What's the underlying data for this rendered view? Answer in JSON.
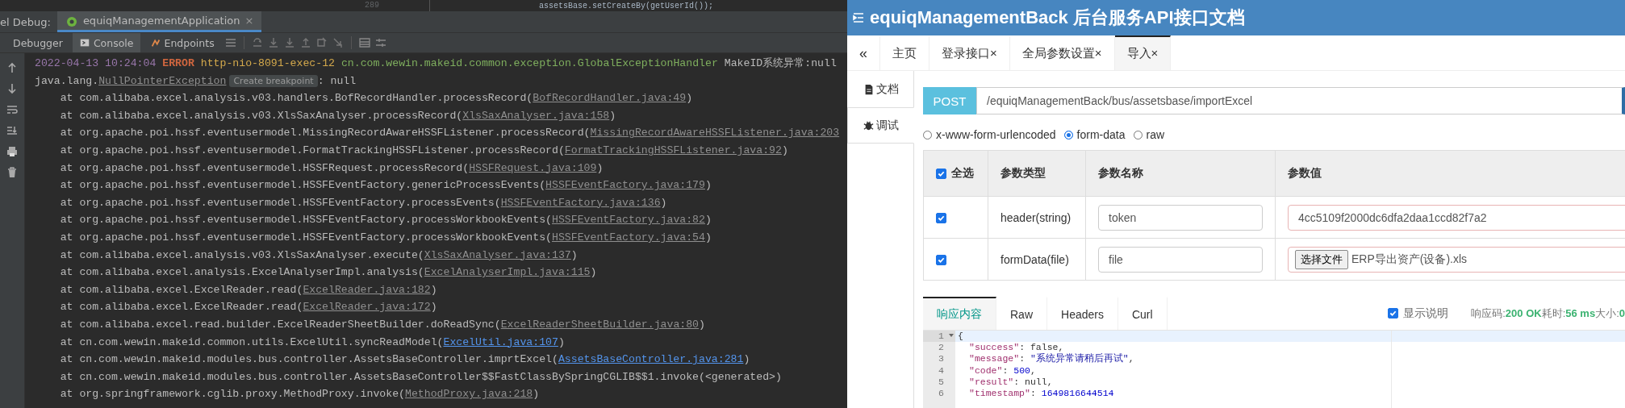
{
  "editor_strip": {
    "line_number": "289",
    "code": "assetsBase.setCreateBy(getUserId());"
  },
  "run_bar": {
    "label": "el Debug:",
    "tab": "equiqManagementApplication",
    "close": "×"
  },
  "tool_tabs": [
    {
      "label": "Debugger",
      "selected": false
    },
    {
      "label": "Console",
      "selected": true
    },
    {
      "label": "Endpoints",
      "selected": false
    }
  ],
  "console": [
    {
      "kind": "log",
      "date": "2022-04-13 10:24:04",
      "level": "ERROR",
      "thread": "http-nio-8091-exec-12",
      "logger": "cn.com.wewin.makeid.common.exception.GlobalExceptionHandler",
      "message": "MakeID系统异常:null"
    },
    {
      "kind": "exception",
      "prefix": "java.lang.",
      "exception": "NullPointerException",
      "hint": "Create breakpoint",
      "suffix": ": null"
    },
    {
      "kind": "frame",
      "text": "at com.alibaba.excel.analysis.v03.handlers.BofRecordHandler.processRecord(",
      "link": "BofRecordHandler.java:49",
      "after": ")",
      "project": false
    },
    {
      "kind": "frame",
      "text": "at com.alibaba.excel.analysis.v03.XlsSaxAnalyser.processRecord(",
      "link": "XlsSaxAnalyser.java:158",
      "after": ")",
      "project": false
    },
    {
      "kind": "frame",
      "text": "at org.apache.poi.hssf.eventusermodel.MissingRecordAwareHSSFListener.processRecord(",
      "link": "MissingRecordAwareHSSFListener.java:203",
      "project": false
    },
    {
      "kind": "frame",
      "text": "at org.apache.poi.hssf.eventusermodel.FormatTrackingHSSFListener.processRecord(",
      "link": "FormatTrackingHSSFListener.java:92",
      "after": ")",
      "project": false
    },
    {
      "kind": "frame",
      "text": "at org.apache.poi.hssf.eventusermodel.HSSFRequest.processRecord(",
      "link": "HSSFRequest.java:109",
      "after": ")",
      "project": false
    },
    {
      "kind": "frame",
      "text": "at org.apache.poi.hssf.eventusermodel.HSSFEventFactory.genericProcessEvents(",
      "link": "HSSFEventFactory.java:179",
      "after": ")",
      "project": false
    },
    {
      "kind": "frame",
      "text": "at org.apache.poi.hssf.eventusermodel.HSSFEventFactory.processEvents(",
      "link": "HSSFEventFactory.java:136",
      "after": ")",
      "project": false
    },
    {
      "kind": "frame",
      "text": "at org.apache.poi.hssf.eventusermodel.HSSFEventFactory.processWorkbookEvents(",
      "link": "HSSFEventFactory.java:82",
      "after": ")",
      "project": false
    },
    {
      "kind": "frame",
      "text": "at org.apache.poi.hssf.eventusermodel.HSSFEventFactory.processWorkbookEvents(",
      "link": "HSSFEventFactory.java:54",
      "after": ")",
      "project": false
    },
    {
      "kind": "frame",
      "text": "at com.alibaba.excel.analysis.v03.XlsSaxAnalyser.execute(",
      "link": "XlsSaxAnalyser.java:137",
      "after": ")",
      "project": false
    },
    {
      "kind": "frame",
      "text": "at com.alibaba.excel.analysis.ExcelAnalyserImpl.analysis(",
      "link": "ExcelAnalyserImpl.java:115",
      "after": ")",
      "project": false
    },
    {
      "kind": "frame",
      "text": "at com.alibaba.excel.ExcelReader.read(",
      "link": "ExcelReader.java:182",
      "after": ")",
      "project": false
    },
    {
      "kind": "frame",
      "text": "at com.alibaba.excel.ExcelReader.read(",
      "link": "ExcelReader.java:172",
      "after": ")",
      "project": false
    },
    {
      "kind": "frame",
      "text": "at com.alibaba.excel.read.builder.ExcelReaderSheetBuilder.doReadSync(",
      "link": "ExcelReaderSheetBuilder.java:80",
      "after": ")",
      "project": false
    },
    {
      "kind": "frame",
      "text": "at cn.com.wewin.makeid.common.utils.ExcelUtil.syncReadModel(",
      "link": "ExcelUtil.java:107",
      "after": ")",
      "project": true
    },
    {
      "kind": "frame",
      "text": "at cn.com.wewin.makeid.modules.bus.controller.AssetsBaseController.imprtExcel(",
      "link": "AssetsBaseController.java:281",
      "after": ")",
      "project": true
    },
    {
      "kind": "frame",
      "text": "at cn.com.wewin.makeid.modules.bus.controller.AssetsBaseController$$FastClassBySpringCGLIB$$1.invoke(<generated>)"
    },
    {
      "kind": "frame",
      "text": "at org.springframework.cglib.proxy.MethodProxy.invoke(",
      "link": "MethodProxy.java:218",
      "after": ")",
      "project": false
    }
  ],
  "doc": {
    "title": "equiqManagementBack 后台服务API接口文档",
    "collapse": "«",
    "tabs": [
      {
        "label": "主页",
        "selected": false
      },
      {
        "label": "登录接口",
        "close": "×",
        "selected": false
      },
      {
        "label": "全局参数设置",
        "close": "×",
        "selected": false
      },
      {
        "label": "导入",
        "close": "×",
        "selected": true
      }
    ],
    "side_nav": [
      {
        "label": "文档",
        "selected": false
      },
      {
        "label": "调试",
        "selected": true
      }
    ],
    "method": "POST",
    "url": "/equiqManagementBack/bus/assetsbase/importExcel",
    "body_types": [
      {
        "label": "x-www-form-urlencoded",
        "selected": false
      },
      {
        "label": "form-data",
        "selected": true
      },
      {
        "label": "raw",
        "selected": false
      }
    ],
    "params": {
      "select_all": {
        "label": "全选",
        "checked": true
      },
      "columns": [
        "参数类型",
        "参数名称",
        "参数值"
      ],
      "rows": [
        {
          "checked": true,
          "kind": "text",
          "type": "header(string)",
          "name": "token",
          "value": "4cc5109f2000dc6dfa2daa1ccd82f7a2"
        },
        {
          "checked": true,
          "kind": "file",
          "type": "formData(file)",
          "name": "file",
          "button": "选择文件",
          "value": "ERP导出资产(设备).xls"
        }
      ]
    },
    "response_tabs": [
      {
        "label": "响应内容",
        "selected": true
      },
      {
        "label": "Raw",
        "selected": false
      },
      {
        "label": "Headers",
        "selected": false
      },
      {
        "label": "Curl",
        "selected": false
      }
    ],
    "show_notes": {
      "label": "显示说明",
      "checked": true
    },
    "status": "响应码:**200 OK**耗时:**56 ms**大小:**0**",
    "code": [
      {
        "number": "1",
        "fold": true,
        "tokens": [
          {
            "kind": "punct",
            "text": "{"
          }
        ]
      },
      {
        "number": "2",
        "fold": false,
        "tokens": [
          {
            "kind": "key",
            "text": "\"success\""
          },
          {
            "kind": "punct",
            "text": ": "
          },
          {
            "kind": "literal",
            "text": "false"
          },
          {
            "kind": "punct",
            "text": ","
          }
        ]
      },
      {
        "number": "3",
        "fold": false,
        "tokens": [
          {
            "kind": "key",
            "text": "\"message\""
          },
          {
            "kind": "punct",
            "text": ": "
          },
          {
            "kind": "string",
            "text": "\"系统异常请稍后再试\""
          },
          {
            "kind": "punct",
            "text": ","
          }
        ]
      },
      {
        "number": "4",
        "fold": false,
        "tokens": [
          {
            "kind": "key",
            "text": "\"code\""
          },
          {
            "kind": "punct",
            "text": ": "
          },
          {
            "kind": "number",
            "text": "500"
          },
          {
            "kind": "punct",
            "text": ","
          }
        ]
      },
      {
        "number": "5",
        "fold": false,
        "tokens": [
          {
            "kind": "key",
            "text": "\"result\""
          },
          {
            "kind": "punct",
            "text": ": "
          },
          {
            "kind": "literal",
            "text": "null"
          },
          {
            "kind": "punct",
            "text": ","
          }
        ]
      },
      {
        "number": "6",
        "fold": false,
        "tokens": [
          {
            "kind": "key",
            "text": "\"timestamp\""
          },
          {
            "kind": "punct",
            "text": ": "
          },
          {
            "kind": "number",
            "text": "1649816644514"
          }
        ]
      }
    ]
  }
}
